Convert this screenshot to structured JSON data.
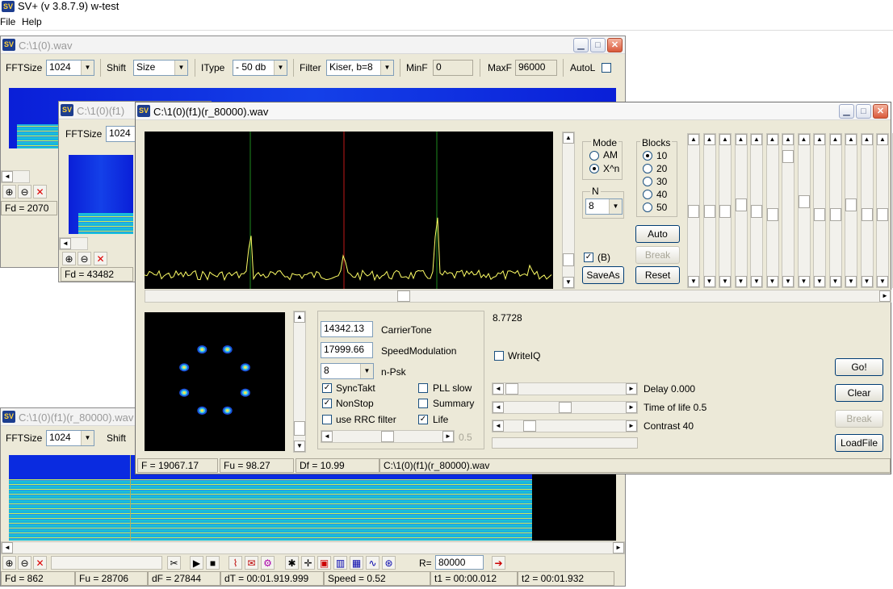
{
  "app": {
    "title": "SV+  (v 3.8.7.9) w-test",
    "logo": "SV",
    "menu": [
      "File",
      "Help"
    ]
  },
  "win1": {
    "title": "C:\\1(0).wav",
    "toolbar": {
      "fftsize_label": "FFTSize",
      "fftsize_value": "1024",
      "shift_label": "Shift",
      "shift_value": "Size",
      "itype_label": "IType",
      "itype_value": "- 50 db",
      "filter_label": "Filter",
      "filter_value": "Kiser, b=8",
      "minf_label": "MinF",
      "minf_value": "0",
      "maxf_label": "MaxF",
      "maxf_value": "96000",
      "autol_label": "AutoL"
    },
    "status_fd": "Fd = 2070"
  },
  "win2": {
    "title": "C:\\1(0)(f1)",
    "fftsize_label": "FFTSize",
    "fftsize_value": "1024",
    "status_fd": "Fd = 43482"
  },
  "win4": {
    "title": "C:\\1(0)(f1)(r_80000).wav",
    "fftsize_label": "FFTSize",
    "fftsize_value": "1024",
    "shift_label": "Shift",
    "r_label": "R=",
    "r_value": "80000",
    "status": [
      "Fd = 862",
      "Fu = 28706",
      "dF = 27844",
      "dT = 00:01.919.999",
      "Speed = 0.52",
      "t1 = 00:00.012",
      "t2 = 00:01.932"
    ]
  },
  "main": {
    "title": "C:\\1(0)(f1)(r_80000).wav",
    "mode": {
      "label": "Mode",
      "options": [
        "AM",
        "X^n"
      ],
      "selected": 1
    },
    "blocks": {
      "label": "Blocks",
      "options": [
        "10",
        "20",
        "30",
        "40",
        "50"
      ],
      "selected": 0
    },
    "n": {
      "label": "N",
      "value": "8"
    },
    "b_label": "(B)",
    "b_checked": true,
    "buttons": {
      "auto": "Auto",
      "break": "Break",
      "saveas": "SaveAs",
      "reset": "Reset",
      "go": "Go!",
      "clear": "Clear",
      "break2": "Break",
      "loadfile": "LoadFile"
    },
    "carrier_value": "14342.13",
    "carrier_label": "CarrierTone",
    "speed_value": "17999.66",
    "speed_label": "SpeedModulation",
    "npsk_value": "8",
    "npsk_label": "n-Psk",
    "checks": [
      {
        "label": "SyncTakt",
        "checked": true
      },
      {
        "label": "PLL slow",
        "checked": false
      },
      {
        "label": "NonStop",
        "checked": true
      },
      {
        "label": "Summary",
        "checked": false
      },
      {
        "label": "use RRC filter",
        "checked": false
      },
      {
        "label": "Life",
        "checked": true
      }
    ],
    "slider_value": "0.5",
    "readout": "8.7728",
    "writeiq_label": "WriteIQ",
    "writeiq_checked": false,
    "sliders": [
      {
        "label": "Delay  0.000",
        "level": 0.0
      },
      {
        "label": "Time of life 0.5",
        "level": 0.5
      },
      {
        "label": "Contrast 40",
        "level": 0.25
      }
    ],
    "status": [
      "F = 19067.17",
      "Fu = 98.27",
      "Df = 10.99",
      "C:\\1(0)(f1)(r_80000).wav"
    ]
  },
  "colors": {
    "accent": "#0a1fd8",
    "trace": "#ffff66",
    "spectrum_bg": "#000000"
  }
}
